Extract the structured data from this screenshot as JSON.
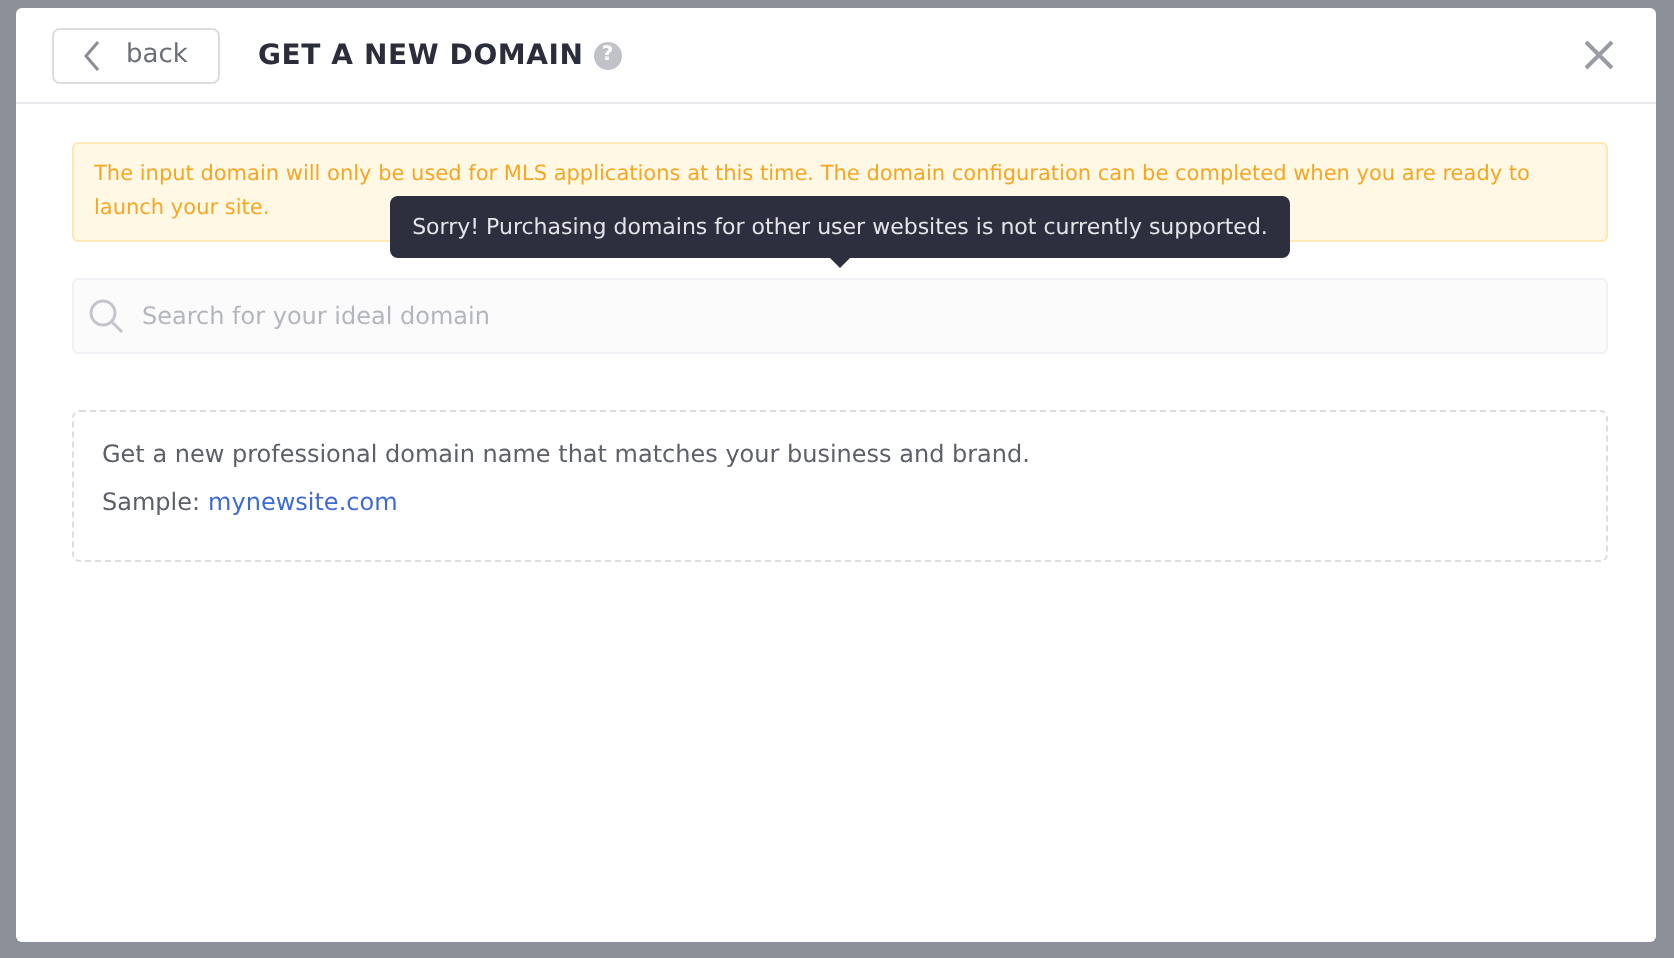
{
  "dialog": {
    "back_button": "back",
    "title": "GET A NEW DOMAIN",
    "help": "?"
  },
  "notice": "The input domain will only be used for MLS applications at this time. The domain configuration can be completed when you are ready to launch your site.",
  "tooltip": "Sorry! Purchasing domains for other user websites is not currently supported.",
  "search": {
    "placeholder": "Search for your ideal domain"
  },
  "info": {
    "description": "Get a new professional domain name that matches your business and brand.",
    "sample_label": "Sample:",
    "sample_link": "mynewsite.com"
  }
}
